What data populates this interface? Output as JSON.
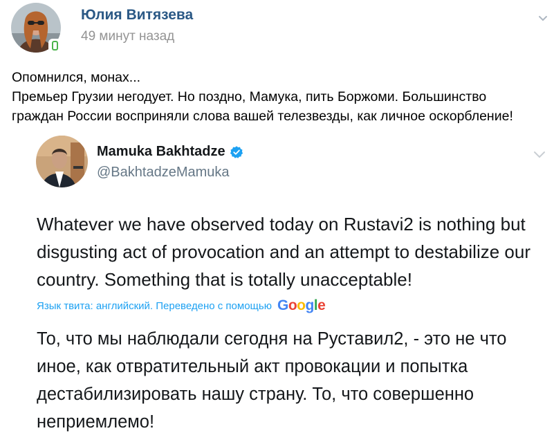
{
  "post": {
    "author": "Юлия Витязева",
    "time": "49 минут назад",
    "lines": [
      "Опомнился, монах...",
      "Премьер Грузии негодует. Но поздно, Мамука, пить Боржоми. Большинство",
      "граждан России восприняли слова вашей телезвезды, как личное оскорбление!"
    ]
  },
  "tweet": {
    "name": "Mamuka Bakhtadze",
    "handle": "@BakhtadzeMamuka",
    "text_lines": [
      "Whatever we have observed today on Rustavi2 is nothing but",
      "disgusting act of provocation and an attempt to destabilize our",
      "country. Something that is totally unacceptable!"
    ],
    "translate_label": "Язык твита: английский. Переведено с помощью",
    "google": {
      "letters": [
        "G",
        "o",
        "o",
        "g",
        "l",
        "e"
      ],
      "colors": [
        "#4285f4",
        "#ea4335",
        "#fbbc05",
        "#4285f4",
        "#34a853",
        "#ea4335"
      ]
    },
    "translation_lines": [
      "То, что мы наблюдали сегодня на Руставил2, - это не что",
      "иное, как отвратительный акт провокации и попытка",
      "дестабилизировать нашу страну. То, что совершенно",
      "неприемлемо!"
    ]
  },
  "colors": {
    "author_link": "#2a5885",
    "muted": "#939393",
    "online": "#4bb34b",
    "twitter_blue": "#1da1f2"
  },
  "icons": {
    "post_menu": "chevron-down-icon",
    "online": "mobile-online-icon",
    "verified": "verified-badge-icon",
    "tweet_menu": "chevron-down-icon"
  }
}
